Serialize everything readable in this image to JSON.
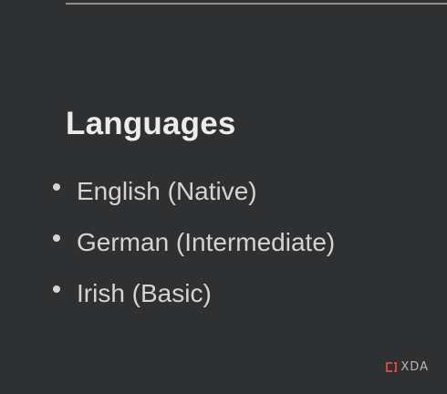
{
  "section": {
    "title": "Languages",
    "items": [
      {
        "label": "English (Native)"
      },
      {
        "label": "German (Intermediate)"
      },
      {
        "label": "Irish (Basic)"
      }
    ]
  },
  "watermark": {
    "text": "XDA",
    "accent_color": "#d64545",
    "icon": "xda-bracket-icon"
  },
  "colors": {
    "background": "#2e3032",
    "heading": "#ececec",
    "body_text": "#d4d4d4",
    "rule": "#8f8f8f"
  }
}
